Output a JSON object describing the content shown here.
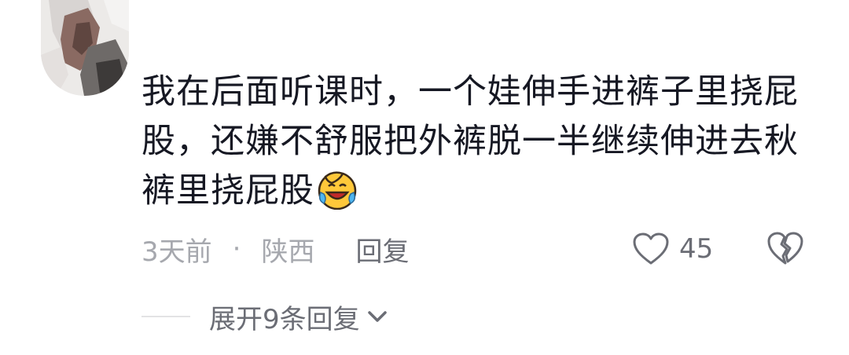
{
  "comment": {
    "avatar_icon": "user-avatar-icon",
    "text": "我在后面听课时，一个娃伸手进裤子里挠屁股，还嫌不舒服把外裤脱一半继续伸进去秋裤里挠屁股",
    "emoji_icon": "laughing-crying-emoji-icon",
    "time": "3天前",
    "separator": "·",
    "location": "陕西",
    "reply_label": "回复",
    "like_icon": "heart-outline-icon",
    "like_count": "45",
    "dislike_icon": "broken-heart-icon"
  },
  "replies": {
    "expand_label": "展开9条回复",
    "expand_icon": "chevron-down-icon"
  },
  "colors": {
    "text_primary": "#161823",
    "text_secondary": "#a6a8ae",
    "text_action": "#6b6d75",
    "divider": "#e3e3e5"
  }
}
